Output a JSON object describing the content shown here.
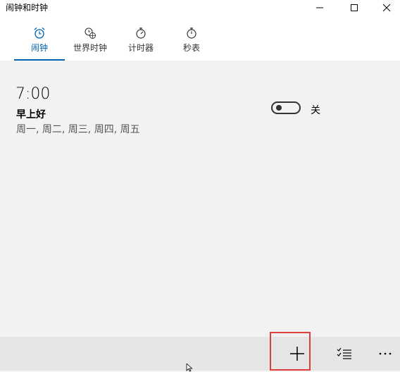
{
  "window": {
    "title": "闹钟和时钟",
    "controls": [
      "minimize-icon",
      "maximize-icon",
      "close-icon"
    ]
  },
  "tabs": [
    {
      "label": "闹钟",
      "icon": "alarm-clock-icon",
      "active": true
    },
    {
      "label": "世界时钟",
      "icon": "world-clock-icon",
      "active": false
    },
    {
      "label": "计时器",
      "icon": "timer-icon",
      "active": false
    },
    {
      "label": "秒表",
      "icon": "stopwatch-icon",
      "active": false
    }
  ],
  "alarm": {
    "time": "7:00",
    "name": "早上好",
    "days": "周一, 周二, 周三, 周四, 周五",
    "toggle_state": "关"
  },
  "bottom_bar": {
    "buttons": [
      "add-icon",
      "select-alarms-icon",
      "more-icon"
    ]
  },
  "colors": {
    "accent": "#0063b1",
    "highlight_box": "#e03c3c",
    "background": "#f2f2f2",
    "bottom_bar": "#e6e6e6"
  }
}
